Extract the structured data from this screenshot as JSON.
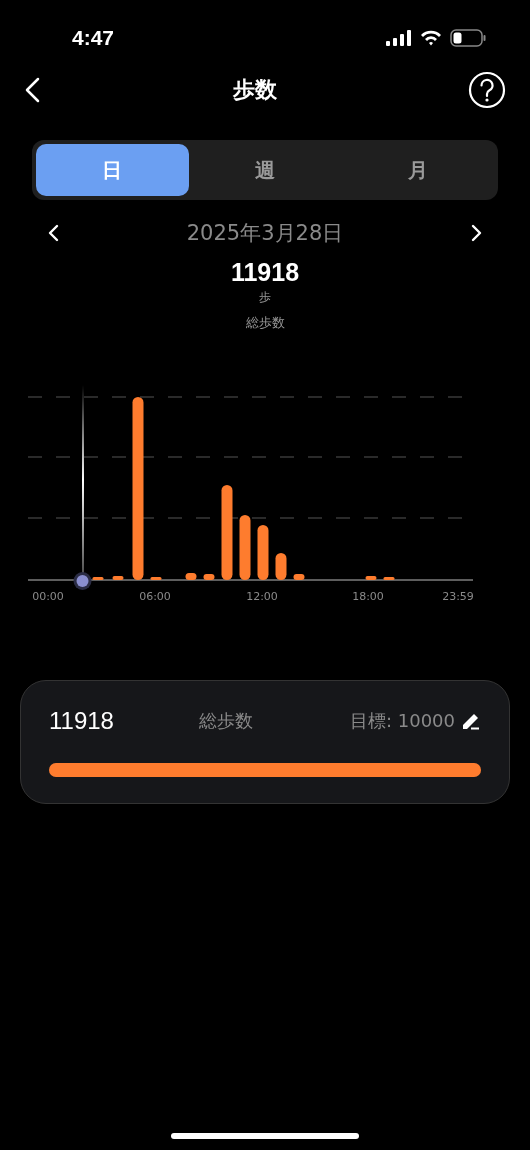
{
  "status_bar": {
    "time": "4:47"
  },
  "nav": {
    "title": "歩数"
  },
  "tabs": [
    {
      "label": "日",
      "selected": true
    },
    {
      "label": "週",
      "selected": false
    },
    {
      "label": "月",
      "selected": false
    }
  ],
  "date": "2025年3月28日",
  "summary": {
    "value": "11918",
    "unit": "歩",
    "caption": "総歩数"
  },
  "chart": {
    "x_labels": [
      "00:00",
      "06:00",
      "12:00",
      "18:00",
      "23:59"
    ]
  },
  "goal_card": {
    "value": "11918",
    "label": "総歩数",
    "goal": "目標: 10000",
    "level": 1
  }
}
